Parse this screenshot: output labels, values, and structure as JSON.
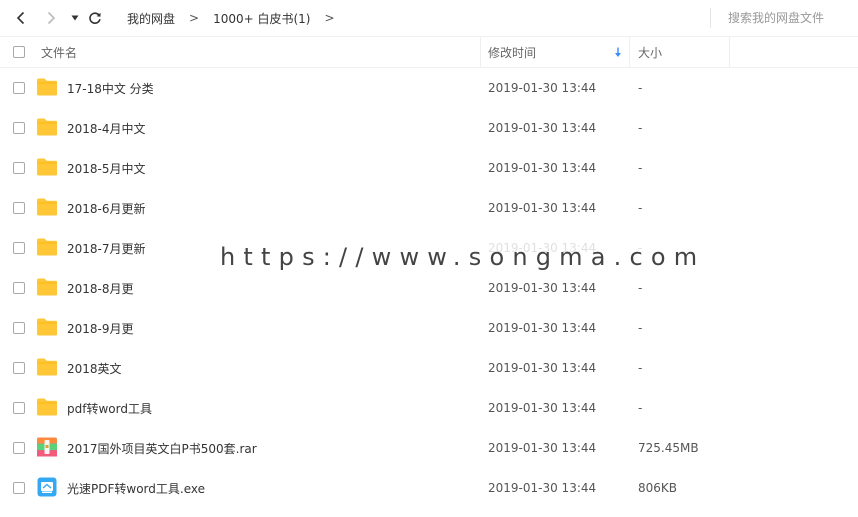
{
  "toolbar": {
    "breadcrumb": [
      {
        "label": "我的网盘"
      },
      {
        "label": "1000+ 白皮书(1)"
      }
    ],
    "separator": ">",
    "search_placeholder": "搜索我的网盘文件"
  },
  "columns": {
    "name": "文件名",
    "modified": "修改时间",
    "size": "大小"
  },
  "files": [
    {
      "name": "17-18中文 分类",
      "modified": "2019-01-30 13:44",
      "size": "-",
      "icon": "folder-icon"
    },
    {
      "name": "2018-4月中文",
      "modified": "2019-01-30 13:44",
      "size": "-",
      "icon": "folder-icon"
    },
    {
      "name": "2018-5月中文",
      "modified": "2019-01-30 13:44",
      "size": "-",
      "icon": "folder-icon"
    },
    {
      "name": "2018-6月更新",
      "modified": "2019-01-30 13:44",
      "size": "-",
      "icon": "folder-icon"
    },
    {
      "name": "2018-7月更新",
      "modified": "2019-01-30 13:44",
      "size": "-",
      "icon": "folder-icon"
    },
    {
      "name": "2018-8月更",
      "modified": "2019-01-30 13:44",
      "size": "-",
      "icon": "folder-icon"
    },
    {
      "name": "2018-9月更",
      "modified": "2019-01-30 13:44",
      "size": "-",
      "icon": "folder-icon"
    },
    {
      "name": "2018英文",
      "modified": "2019-01-30 13:44",
      "size": "-",
      "icon": "folder-icon"
    },
    {
      "name": "pdf转word工具",
      "modified": "2019-01-30 13:44",
      "size": "-",
      "icon": "folder-icon"
    },
    {
      "name": "2017国外项目英文白P书500套.rar",
      "modified": "2019-01-30 13:44",
      "size": "725.45MB",
      "icon": "rar-archive-icon"
    },
    {
      "name": "光速PDF转word工具.exe",
      "modified": "2019-01-30 13:44",
      "size": "806KB",
      "icon": "exe-file-icon"
    }
  ],
  "watermark": "https://www.songma.com",
  "colors": {
    "folder": "#FFC735",
    "sort_arrow": "#3B8CFF",
    "text": "#333333",
    "muted": "#999999"
  }
}
